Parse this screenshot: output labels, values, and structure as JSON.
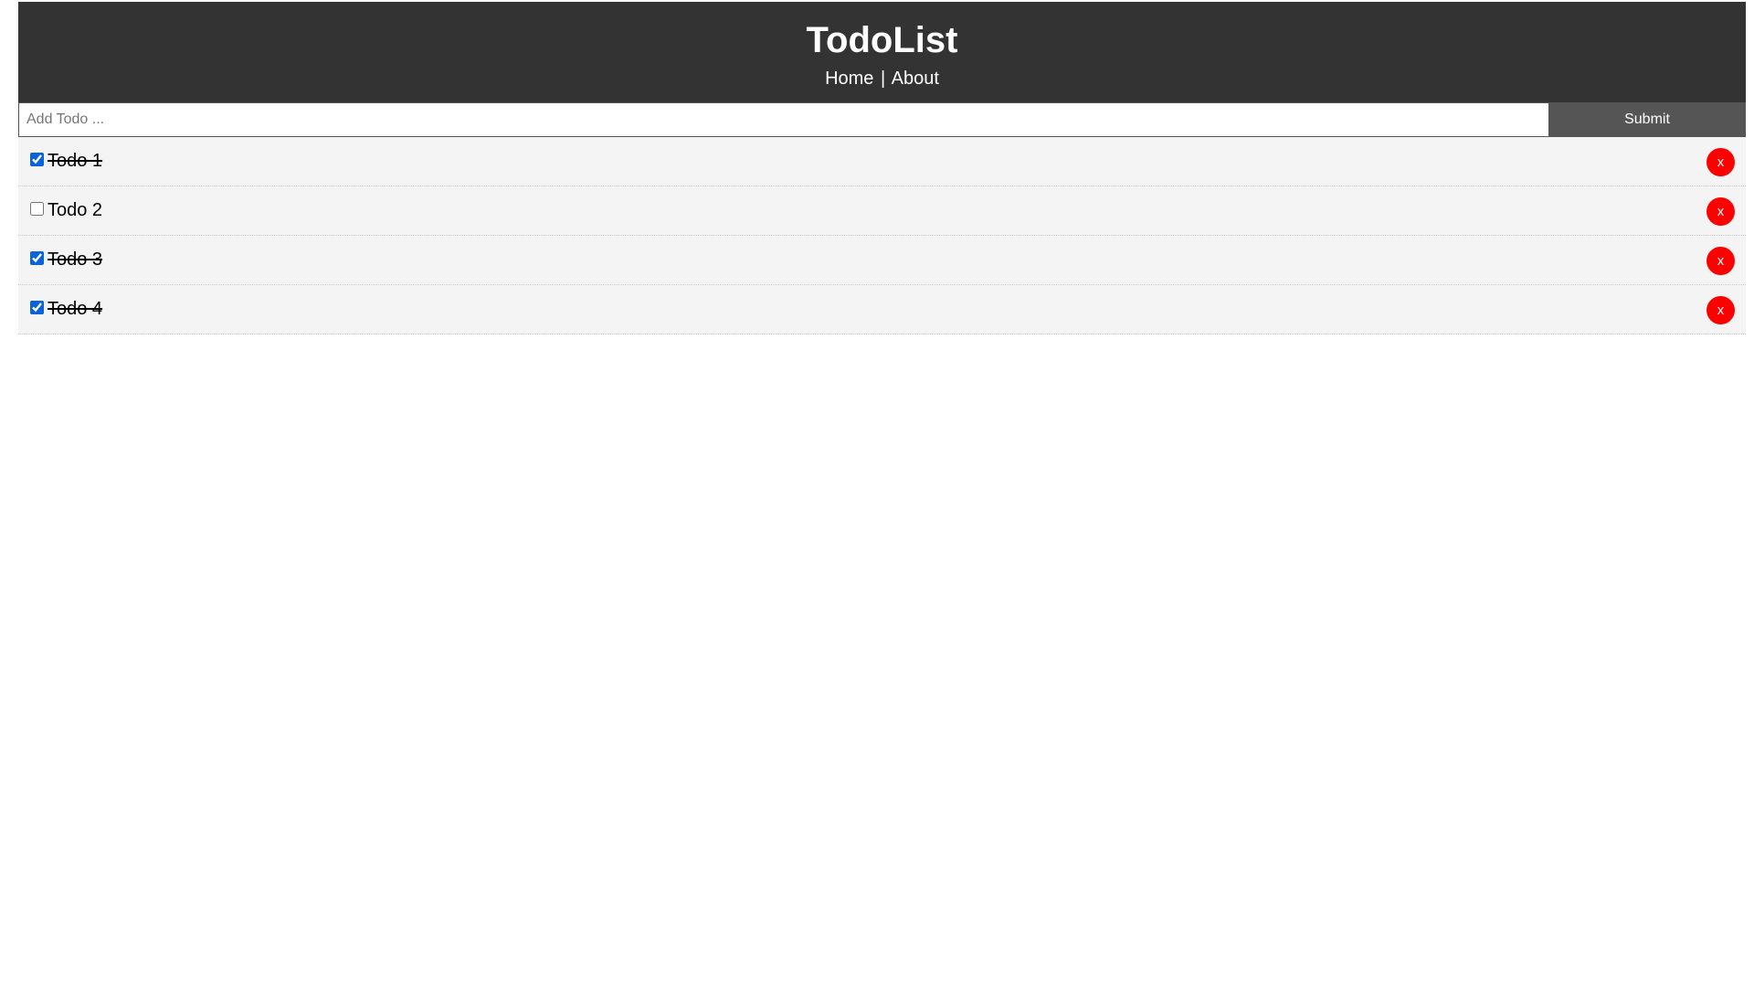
{
  "header": {
    "title": "TodoList",
    "nav": {
      "home": "Home",
      "separator": "|",
      "about": "About"
    }
  },
  "add_form": {
    "placeholder": "Add Todo ...",
    "value": "",
    "submit_label": "Submit"
  },
  "todos": [
    {
      "title": "Todo 1",
      "completed": true,
      "delete_label": "x"
    },
    {
      "title": "Todo 2",
      "completed": false,
      "delete_label": "x"
    },
    {
      "title": "Todo 3",
      "completed": true,
      "delete_label": "x"
    },
    {
      "title": "Todo 4",
      "completed": true,
      "delete_label": "x"
    }
  ],
  "colors": {
    "header_bg": "#333333",
    "submit_bg": "#555555",
    "item_bg": "#f4f4f4",
    "delete_bg": "#ff0000",
    "checkbox_accent": "#0a64d8"
  }
}
